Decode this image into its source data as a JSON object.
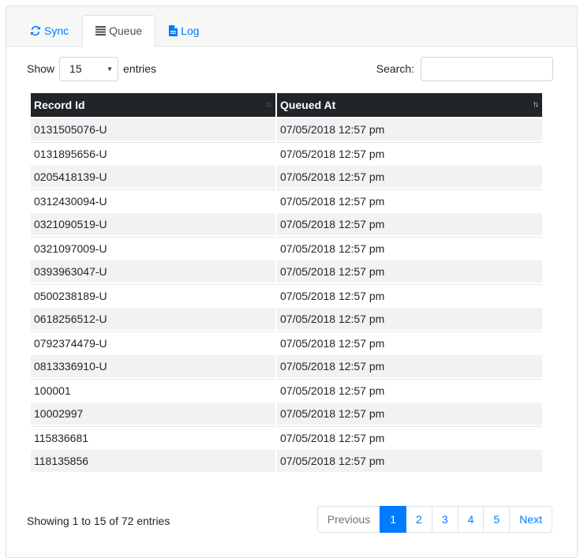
{
  "tabs": [
    {
      "label": "Sync",
      "icon": "sync-icon"
    },
    {
      "label": "Queue",
      "icon": "list-icon"
    },
    {
      "label": "Log",
      "icon": "file-icon"
    }
  ],
  "length": {
    "prefix": "Show",
    "value": "15",
    "suffix": "entries"
  },
  "search": {
    "label": "Search:",
    "value": ""
  },
  "table": {
    "columns": [
      "Record Id",
      "Queued At"
    ],
    "rows": [
      [
        "0131505076-U",
        "07/05/2018 12:57 pm"
      ],
      [
        "0131895656-U",
        "07/05/2018 12:57 pm"
      ],
      [
        "0205418139-U",
        "07/05/2018 12:57 pm"
      ],
      [
        "0312430094-U",
        "07/05/2018 12:57 pm"
      ],
      [
        "0321090519-U",
        "07/05/2018 12:57 pm"
      ],
      [
        "0321097009-U",
        "07/05/2018 12:57 pm"
      ],
      [
        "0393963047-U",
        "07/05/2018 12:57 pm"
      ],
      [
        "0500238189-U",
        "07/05/2018 12:57 pm"
      ],
      [
        "0618256512-U",
        "07/05/2018 12:57 pm"
      ],
      [
        "0792374479-U",
        "07/05/2018 12:57 pm"
      ],
      [
        "0813336910-U",
        "07/05/2018 12:57 pm"
      ],
      [
        "100001",
        "07/05/2018 12:57 pm"
      ],
      [
        "10002997",
        "07/05/2018 12:57 pm"
      ],
      [
        "115836681",
        "07/05/2018 12:57 pm"
      ],
      [
        "118135856",
        "07/05/2018 12:57 pm"
      ]
    ]
  },
  "info": "Showing 1 to 15 of 72 entries",
  "pagination": {
    "previous": "Previous",
    "pages": [
      "1",
      "2",
      "3",
      "4",
      "5"
    ],
    "active": "1",
    "next": "Next"
  },
  "colors": {
    "accent": "#007bff",
    "header_bg": "#212529",
    "stripe": "#f2f2f2"
  }
}
